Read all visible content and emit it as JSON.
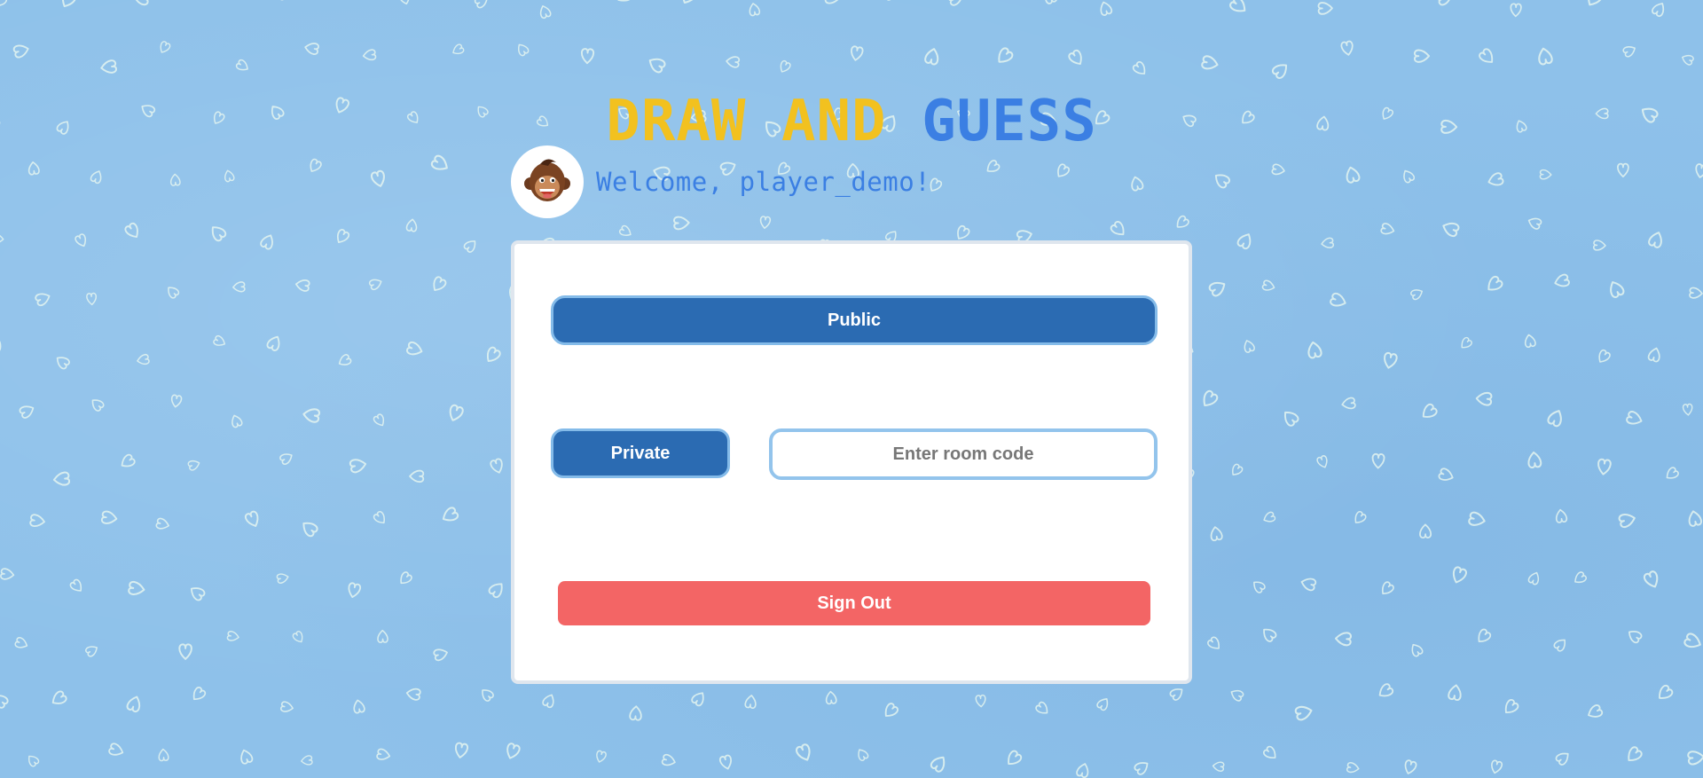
{
  "title": {
    "part1": "DRAW AND",
    "part2": "GUESS",
    "color1": "#f2c11f",
    "color2": "#3b7fe3"
  },
  "user": {
    "welcome": "Welcome, player_demo!",
    "avatar_icon": "monkey-avatar-icon"
  },
  "lobby": {
    "public_label": "Public",
    "private_label": "Private",
    "room_code_placeholder": "Enter room code",
    "room_code_value": "",
    "signout_label": "Sign Out"
  },
  "colors": {
    "background": "#8ec1ea",
    "primary_button": "#2b6bb2",
    "button_border": "#84bbe9",
    "signout": "#f36565"
  },
  "background_pattern_icon": "heart-doodle-icon"
}
